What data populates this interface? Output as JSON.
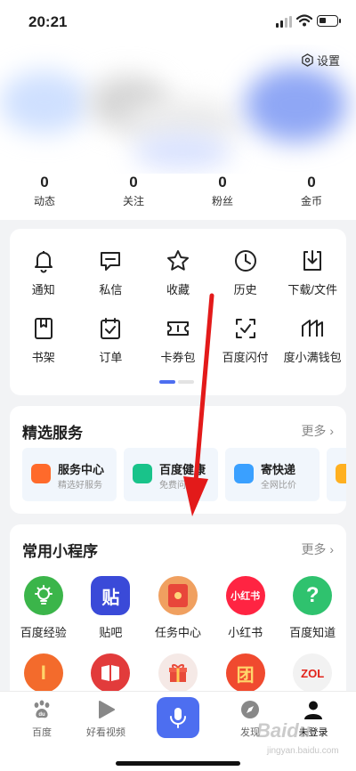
{
  "status_bar": {
    "time": "20:21"
  },
  "profile": {
    "settings_label": "设置"
  },
  "stats": [
    {
      "value": "0",
      "label": "动态"
    },
    {
      "value": "0",
      "label": "关注"
    },
    {
      "value": "0",
      "label": "粉丝"
    },
    {
      "value": "0",
      "label": "金币"
    }
  ],
  "grid": {
    "row1": [
      {
        "icon": "bell-icon",
        "label": "通知"
      },
      {
        "icon": "message-icon",
        "label": "私信"
      },
      {
        "icon": "star-icon",
        "label": "收藏"
      },
      {
        "icon": "clock-icon",
        "label": "历史"
      },
      {
        "icon": "download-icon",
        "label": "下载/文件"
      }
    ],
    "row2": [
      {
        "icon": "bookshelf-icon",
        "label": "书架"
      },
      {
        "icon": "order-icon",
        "label": "订单"
      },
      {
        "icon": "ticket-icon",
        "label": "卡券包"
      },
      {
        "icon": "scan-check-icon",
        "label": "百度闪付"
      },
      {
        "icon": "wallet-icon",
        "label": "度小满钱包"
      }
    ]
  },
  "services": {
    "title": "精选服务",
    "more": "更多",
    "items": [
      {
        "name": "服务中心",
        "desc": "精选好服务",
        "color": "#ff6a2b"
      },
      {
        "name": "百度健康",
        "desc": "免费问医生",
        "color": "#19c38a"
      },
      {
        "name": "寄快递",
        "desc": "全网比价",
        "color": "#3aa0ff"
      },
      {
        "name": "",
        "desc": "",
        "color": "#ffb020"
      }
    ]
  },
  "mini_programs": {
    "title": "常用小程序",
    "more": "更多",
    "row1": [
      {
        "label": "百度经验",
        "icon": "bulb-icon",
        "color": "#3bb54a"
      },
      {
        "label": "贴吧",
        "icon": "tieba-icon",
        "color": "#3a4ad8",
        "glyph": "贴"
      },
      {
        "label": "任务中心",
        "icon": "red-envelope-icon",
        "color": "#f0a060"
      },
      {
        "label": "小红书",
        "icon": "xiaohongshu-icon",
        "color": "#ff2442",
        "glyph": "小红书"
      },
      {
        "label": "百度知道",
        "icon": "question-icon",
        "color": "#2fc26e",
        "glyph": "?"
      }
    ],
    "row2": [
      {
        "icon": "coin-pot-icon",
        "color": "#f36b2c",
        "glyph": "I"
      },
      {
        "icon": "book-icon",
        "color": "#e23b3b"
      },
      {
        "icon": "gift-icon",
        "color": "#f5e9e6"
      },
      {
        "icon": "group-buy-icon",
        "color": "#f04a2f",
        "glyph": "团"
      },
      {
        "icon": "zol-icon",
        "color": "#f2f2f2",
        "glyph": "ZOL"
      }
    ]
  },
  "tabbar": {
    "home": "百度",
    "video": "好看视频",
    "discover": "发现",
    "login": "未登录"
  },
  "watermark": {
    "brand": "Baidu",
    "sub": "jingyan.baidu.com"
  }
}
